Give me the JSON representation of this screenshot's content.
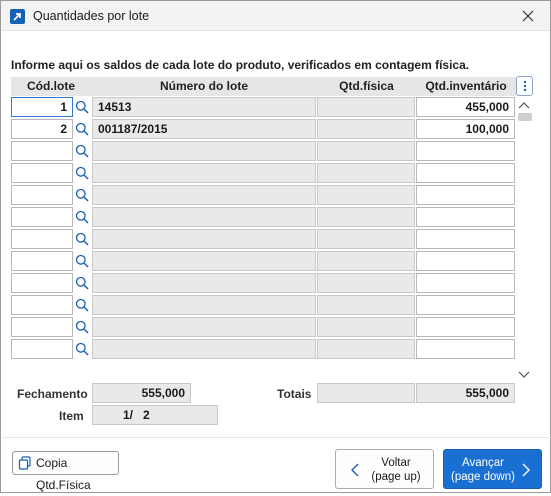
{
  "window": {
    "title": "Quantidades por lote"
  },
  "instruction": "Informe aqui os saldos de cada lote do produto, verificados em contagem física.",
  "columns": {
    "cod_lote": "Cód.lote",
    "numero_lote": "Número do lote",
    "qtd_fisica": "Qtd.física",
    "qtd_inventario": "Qtd.inventário"
  },
  "rows": [
    {
      "cod": "1",
      "numero": "14513",
      "fisica": "",
      "inventario": "455,000"
    },
    {
      "cod": "2",
      "numero": "001187/2015",
      "fisica": "",
      "inventario": "100,000"
    },
    {
      "cod": "",
      "numero": "",
      "fisica": "",
      "inventario": ""
    },
    {
      "cod": "",
      "numero": "",
      "fisica": "",
      "inventario": ""
    },
    {
      "cod": "",
      "numero": "",
      "fisica": "",
      "inventario": ""
    },
    {
      "cod": "",
      "numero": "",
      "fisica": "",
      "inventario": ""
    },
    {
      "cod": "",
      "numero": "",
      "fisica": "",
      "inventario": ""
    },
    {
      "cod": "",
      "numero": "",
      "fisica": "",
      "inventario": ""
    },
    {
      "cod": "",
      "numero": "",
      "fisica": "",
      "inventario": ""
    },
    {
      "cod": "",
      "numero": "",
      "fisica": "",
      "inventario": ""
    },
    {
      "cod": "",
      "numero": "",
      "fisica": "",
      "inventario": ""
    },
    {
      "cod": "",
      "numero": "",
      "fisica": "",
      "inventario": ""
    }
  ],
  "footer": {
    "fechamento_label": "Fechamento",
    "fechamento_value": "555,000",
    "totais_label": "Totais",
    "totais_fisica": "",
    "totais_inventario": "555,000",
    "item_label": "Item",
    "item_value": "1/   2"
  },
  "buttons": {
    "copy": "Copia Qtd.Física",
    "back_line1": "Voltar",
    "back_line2": "(page up)",
    "next_line1": "Avançar",
    "next_line2": "(page down)"
  },
  "colors": {
    "accent": "#1a6fd3",
    "focus_border": "#2f78d4",
    "header_bg": "#e6e6e6",
    "readonly_bg": "#e9e9e9"
  },
  "icons": [
    "app-arrow-icon",
    "close-icon",
    "search-icon",
    "kebab-menu-icon",
    "chevron-up-icon",
    "chevron-down-icon",
    "copy-icon",
    "chevron-left-icon",
    "chevron-right-icon"
  ]
}
